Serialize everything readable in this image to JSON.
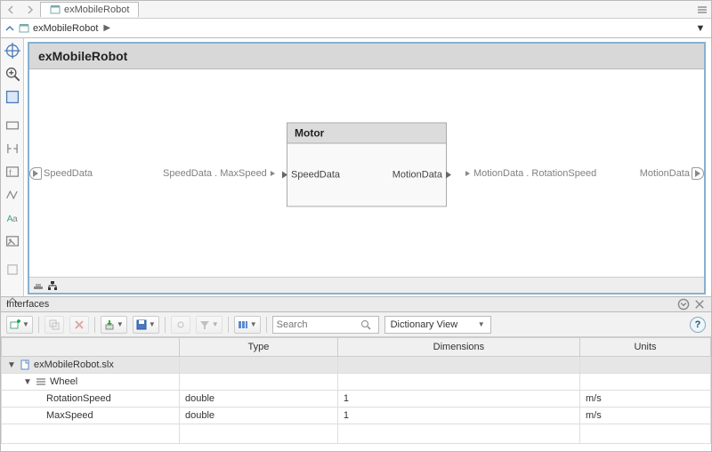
{
  "tab": {
    "title": "exMobileRobot"
  },
  "breadcrumb": {
    "root": "exMobileRobot"
  },
  "canvas": {
    "title": "exMobileRobot",
    "input_port": "SpeedData",
    "output_port": "MotionData",
    "block": {
      "title": "Motor",
      "in_port": "SpeedData",
      "out_port": "MotionData"
    },
    "conn_in_label": "SpeedData . MaxSpeed",
    "conn_out_label": "MotionData . RotationSpeed"
  },
  "interfaces": {
    "panel_title": "Interfaces",
    "search_placeholder": "Search",
    "view_label": "Dictionary View",
    "columns": {
      "c0": "",
      "c1": "Type",
      "c2": "Dimensions",
      "c3": "Units"
    },
    "rows": [
      {
        "kind": "file",
        "indent": 0,
        "toggle": "▼",
        "label": "exMobileRobot.slx",
        "type": "",
        "dim": "",
        "units": ""
      },
      {
        "kind": "iface",
        "indent": 1,
        "toggle": "▼",
        "label": "Wheel",
        "type": "",
        "dim": "",
        "units": ""
      },
      {
        "kind": "elem",
        "indent": 2,
        "toggle": "",
        "label": "RotationSpeed",
        "type": "double",
        "dim": "1",
        "units": "m/s"
      },
      {
        "kind": "elem",
        "indent": 2,
        "toggle": "",
        "label": "MaxSpeed",
        "type": "double",
        "dim": "1",
        "units": "m/s"
      }
    ]
  }
}
